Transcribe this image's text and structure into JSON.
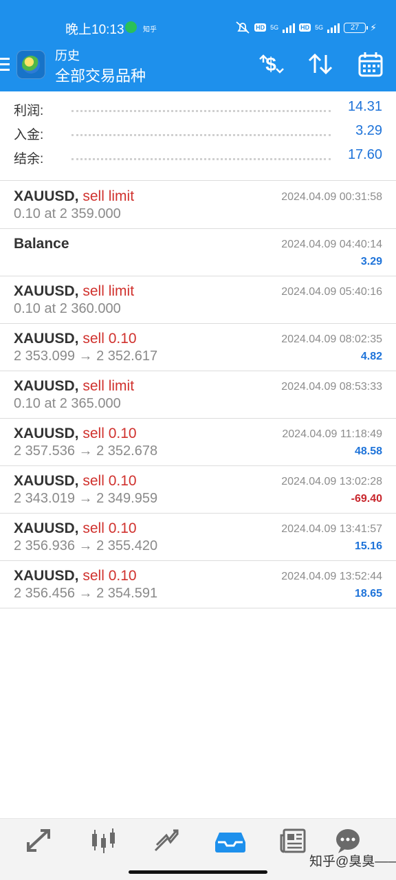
{
  "status_bar": {
    "time": "晚上10:13",
    "app_label": "知乎",
    "hd1": "HD",
    "hd2": "HD",
    "net1": "5G",
    "net2": "5G",
    "battery": "27"
  },
  "header": {
    "title": "历史",
    "subtitle": "全部交易品种",
    "icons": [
      "menu-icon",
      "app-logo",
      "dollar-sort-icon",
      "sort-updown-icon",
      "calendar-icon"
    ]
  },
  "summary": [
    {
      "label": "利润:",
      "value": "14.31"
    },
    {
      "label": "入金:",
      "value": "3.29"
    },
    {
      "label": "结余:",
      "value": "17.60"
    }
  ],
  "history": [
    {
      "symbol": "XAUUSD,",
      "type": "sell limit",
      "detail": "0.10 at 2 359.000",
      "datetime": "2024.04.09 00:31:58",
      "profit": ""
    },
    {
      "symbol": "Balance",
      "type": "",
      "detail": "",
      "datetime": "2024.04.09 04:40:14",
      "profit": "3.29"
    },
    {
      "symbol": "XAUUSD,",
      "type": "sell limit",
      "detail": "0.10 at 2 360.000",
      "datetime": "2024.04.09 05:40:16",
      "profit": ""
    },
    {
      "symbol": "XAUUSD,",
      "type": "sell 0.10",
      "detail": "2 353.099 → 2 352.617",
      "datetime": "2024.04.09 08:02:35",
      "profit": "4.82"
    },
    {
      "symbol": "XAUUSD,",
      "type": "sell limit",
      "detail": "0.10 at 2 365.000",
      "datetime": "2024.04.09 08:53:33",
      "profit": ""
    },
    {
      "symbol": "XAUUSD,",
      "type": "sell 0.10",
      "detail": "2 357.536 → 2 352.678",
      "datetime": "2024.04.09 11:18:49",
      "profit": "48.58"
    },
    {
      "symbol": "XAUUSD,",
      "type": "sell 0.10",
      "detail": "2 343.019 → 2 349.959",
      "datetime": "2024.04.09 13:02:28",
      "profit": "-69.40"
    },
    {
      "symbol": "XAUUSD,",
      "type": "sell 0.10",
      "detail": "2 356.936 → 2 355.420",
      "datetime": "2024.04.09 13:41:57",
      "profit": "15.16"
    },
    {
      "symbol": "XAUUSD,",
      "type": "sell 0.10",
      "detail": "2 356.456 → 2 354.591",
      "datetime": "2024.04.09 13:52:44",
      "profit": "18.65"
    }
  ],
  "bottom_nav": {
    "items": [
      "quotes-icon",
      "chart-icon",
      "trade-icon",
      "history-icon",
      "news-icon",
      "chat-icon"
    ],
    "active": "history-icon"
  },
  "watermark": "知乎@臭臭——",
  "colors": {
    "header_blue": "#1e90ec",
    "profit_blue": "#1e73d9",
    "loss_red": "#c8262c",
    "order_red": "#d0312d"
  }
}
